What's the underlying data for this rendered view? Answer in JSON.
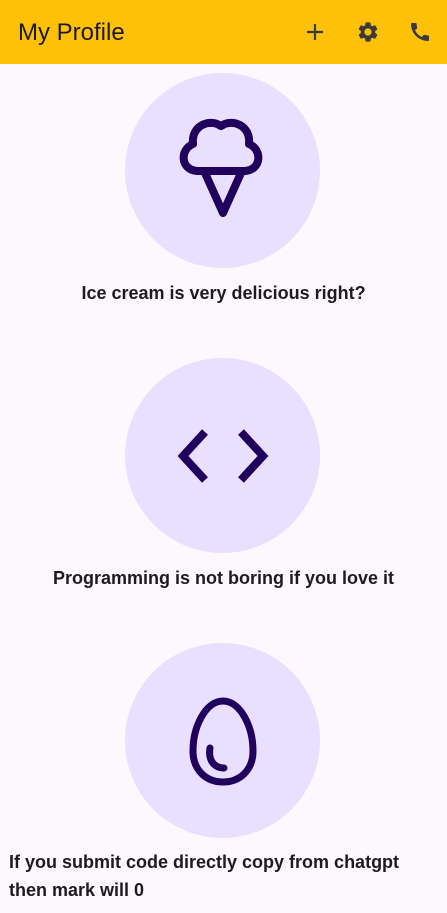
{
  "app_bar": {
    "title": "My Profile",
    "background": "#FFC107",
    "actions": [
      {
        "icon": "plus-icon"
      },
      {
        "icon": "gear-icon"
      },
      {
        "icon": "phone-icon"
      }
    ]
  },
  "items": [
    {
      "icon": "ice-cream-icon",
      "caption": "Ice cream is very delicious right?"
    },
    {
      "icon": "code-icon",
      "caption": "Programming is not boring if you love it"
    },
    {
      "icon": "egg-icon",
      "caption": "If you submit code directly copy from chatgpt then mark will 0"
    }
  ],
  "colors": {
    "circle": "#E9DFFF",
    "icon": "#21005D",
    "background": "#FDF7FE"
  }
}
